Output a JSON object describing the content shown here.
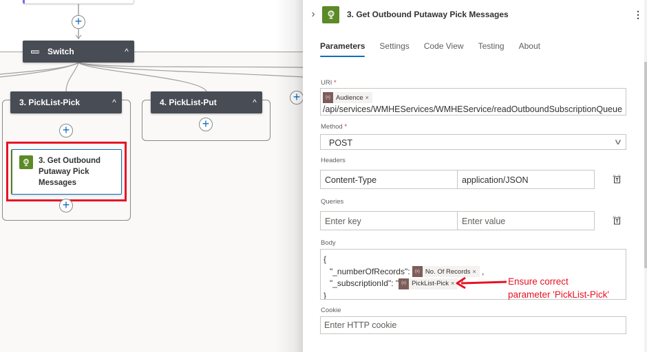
{
  "canvas": {
    "switch": {
      "label": "Switch",
      "icon": "switch-icon",
      "collapse_icon": "chevron-up-icon"
    },
    "cases": [
      {
        "label": "3. PickList-Pick",
        "collapse_icon": "chevron-up-icon"
      },
      {
        "label": "4. PickList-Put",
        "collapse_icon": "chevron-up-icon"
      }
    ],
    "action_card": {
      "title": "3. Get Outbound Putaway Pick Messages",
      "icon": "globe-icon"
    },
    "add_step_symbol": "+",
    "chevron_up": "^"
  },
  "panel": {
    "collapse_symbol": "›",
    "title": "3. Get Outbound Putaway Pick Messages",
    "icon": "globe-icon",
    "more_symbol": "⋮",
    "tabs": [
      {
        "label": "Parameters",
        "active": true
      },
      {
        "label": "Settings",
        "active": false
      },
      {
        "label": "Code View",
        "active": false
      },
      {
        "label": "Testing",
        "active": false
      },
      {
        "label": "About",
        "active": false
      }
    ],
    "uri": {
      "label": "URI",
      "required_mark": "*",
      "token": "Audience",
      "text": "/api/services/WMHEServices/WMHEService/readOutboundSubscriptionQueue"
    },
    "method": {
      "label": "Method",
      "required_mark": "*",
      "value": "POST",
      "dropdown_symbol": "v"
    },
    "headers": {
      "label": "Headers",
      "key": "Content-Type",
      "value": "application/JSON"
    },
    "queries": {
      "label": "Queries",
      "key_placeholder": "Enter key",
      "value_placeholder": "Enter value"
    },
    "body": {
      "label": "Body",
      "open_brace": "{",
      "line1_key": "\"_numberOfRecords\":",
      "line1_token": "No. Of Records",
      "line1_suffix": ",",
      "line2_key": "\"_subscriptionId\": \"",
      "line2_token": "PickList-Pick",
      "line2_suffix": "\"",
      "close_brace": "}"
    },
    "cookie": {
      "label": "Cookie",
      "placeholder": "Enter HTTP cookie"
    },
    "token_close": "×",
    "token_icon_text": "{x}"
  },
  "annotation": {
    "line1": "Ensure correct",
    "line2": "parameter 'PickList-Pick'",
    "color": "#e81123"
  },
  "colors": {
    "accent": "#0f6cbd",
    "action_green": "#5c8a26",
    "node_header": "#484c54",
    "token_icon": "#7e5c5a",
    "highlight": "#e81123"
  }
}
